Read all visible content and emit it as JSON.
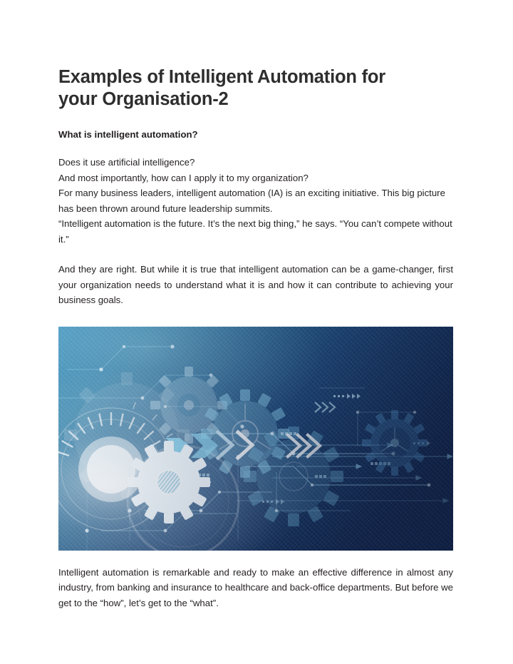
{
  "document": {
    "title": "Examples of Intelligent Automation for your Organisation-2",
    "subheading": "What is intelligent automation?",
    "paragraphs": {
      "lead": {
        "line1": "Does it use artificial intelligence?",
        "line2": "And most importantly, how can I apply it to my organization?",
        "line3": "For many business leaders, intelligent automation (IA) is an exciting initiative. This big picture has been thrown around future leadership summits.",
        "line4": "“Intelligent automation is the future. It’s the next big thing,” he says. “You can’t compete without it.”"
      },
      "body": "And they are right. But while it is true that intelligent automation can be a game-changer, first your organization needs to understand what it is and how it can contribute to achieving your business goals.",
      "closing": "Intelligent automation is remarkable and ready to make an effective difference in almost any industry, from banking and insurance to healthcare and back-office departments. But before we get to the “how”, let’s get to the “what”."
    },
    "figure": {
      "alt_text": "Abstract blue technology background with interlocking gears, circuit board traces, node dots and forward chevron arrows",
      "colors": {
        "teal_light": "#3f92bd",
        "teal_mid": "#2e7fa8",
        "navy_mid": "#1d3f6e",
        "navy_dark": "#152a52",
        "navy_deep": "#10203f",
        "accent_cyan": "#7fd4f2",
        "gear_white": "#f2f7fb",
        "line_blue": "#9fd8ef"
      }
    }
  }
}
